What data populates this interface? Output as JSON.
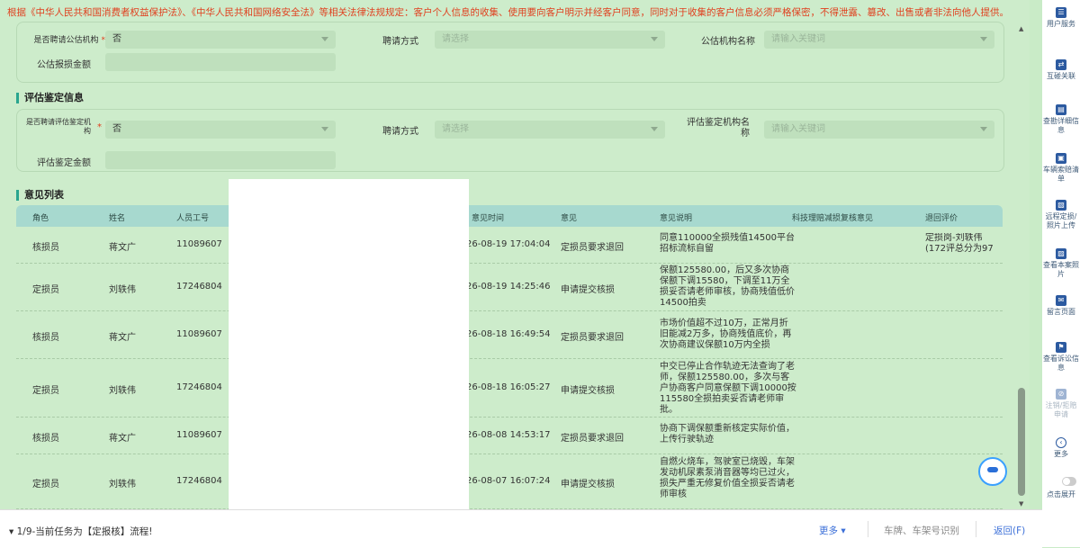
{
  "notice": "根据《中华人民共和国消费者权益保护法》、《中华人民共和国网络安全法》等相关法律法规规定：客户个人信息的收集、使用要向客户明示并经客户同意，同时对于收集的客户信息必须严格保密，不得泄露、篡改、出售或者非法向他人提供。",
  "public_estimate": {
    "engage_label": "是否聘请公估机构",
    "engage_value": "否",
    "method_label": "聘请方式",
    "method_placeholder": "请选择",
    "org_label": "公估机构名称",
    "org_placeholder": "请输入关键词",
    "amount_label": "公估报损金额"
  },
  "assessment": {
    "section_title": "评估鉴定信息",
    "engage_label": "是否聘请评估鉴定机构",
    "engage_value": "否",
    "method_label": "聘请方式",
    "method_placeholder": "请选择",
    "org_label": "评估鉴定机构名称",
    "org_placeholder": "请输入关键词",
    "amount_label": "评估鉴定金额"
  },
  "opinions": {
    "section_title": "意见列表",
    "columns": [
      "角色",
      "姓名",
      "人员工号",
      "意见时间",
      "意见",
      "意见说明",
      "科技理赔减损复核意见",
      "退回评价"
    ],
    "rows": [
      {
        "role": "核损员",
        "name": "蒋文广",
        "id": "11089607",
        "time": "26-08-19 17:04:04",
        "opinion": "定损员要求退回",
        "desc": "同意110000全损残值14500平台招标流标自留",
        "review": "",
        "evaluation": "定损岗-刘轶伟(172评总分为97"
      },
      {
        "role": "定损员",
        "name": "刘轶伟",
        "id": "17246804",
        "time": "26-08-19 14:25:46",
        "opinion": "申请提交核损",
        "desc": "保额125580.00，后又多次协商保额下调15580，下调至11万全损妥否请老师审核，协商残值低价14500拍卖",
        "review": "",
        "evaluation": ""
      },
      {
        "role": "核损员",
        "name": "蒋文广",
        "id": "11089607",
        "time": "26-08-18 16:49:54",
        "opinion": "定损员要求退回",
        "desc": "市场价值超不过10万，正常月折旧能减2万多，协商残值底价，再次协商建议保额10万内全损",
        "review": "",
        "evaluation": ""
      },
      {
        "role": "定损员",
        "name": "刘轶伟",
        "id": "17246804",
        "time": "26-08-18 16:05:27",
        "opinion": "申请提交核损",
        "desc": "中交已停止合作轨迹无法查询了老师，保额125580.00，多次与客户协商客户同意保额下调10000按115580全损拍卖妥否请老师审批。",
        "review": "",
        "evaluation": ""
      },
      {
        "role": "核损员",
        "name": "蒋文广",
        "id": "11089607",
        "time": "26-08-08 14:53:17",
        "opinion": "定损员要求退回",
        "desc": "协商下调保额重新核定实际价值，上传行驶轨迹",
        "review": "",
        "evaluation": ""
      },
      {
        "role": "定损员",
        "name": "刘轶伟",
        "id": "17246804",
        "time": "26-08-07 16:07:24",
        "opinion": "申请提交核损",
        "desc": "自燃火烧车，驾驶室已烧毁，车架发动机尿素泵消音器等均已过火，损失严重无修复价值全损妥否请老师审核",
        "review": "",
        "evaluation": ""
      }
    ]
  },
  "sidebar": [
    {
      "icon": "user-service-icon",
      "glyph": "☰",
      "label": "用户服务"
    },
    {
      "icon": "link-icon",
      "glyph": "⇄",
      "label": "互碰关联"
    },
    {
      "icon": "survey-icon",
      "glyph": "▤",
      "label": "查勘详细信息"
    },
    {
      "icon": "car-list-icon",
      "glyph": "▣",
      "label": "车辆索赔清单"
    },
    {
      "icon": "photo-upload-icon",
      "glyph": "▧",
      "label": "远程定损/照片上传"
    },
    {
      "icon": "photo-icon",
      "glyph": "▨",
      "label": "查看本案照片"
    },
    {
      "icon": "message-icon",
      "glyph": "✉",
      "label": "留言页面"
    },
    {
      "icon": "complaint-icon",
      "glyph": "⚑",
      "label": "查看诉讼信息"
    },
    {
      "icon": "cancel-icon",
      "glyph": "⊘",
      "label": "注销/拒赔申请"
    },
    {
      "icon": "more-icon",
      "glyph": "‹",
      "label": "更多"
    },
    {
      "icon": "toggle-icon",
      "glyph": "",
      "label": "点击展开"
    }
  ],
  "bottom": {
    "task": "1/9-当前任务为【定报核】流程!",
    "more": "更多",
    "plate": "车牌、车架号识别",
    "back": "返回(F)"
  }
}
